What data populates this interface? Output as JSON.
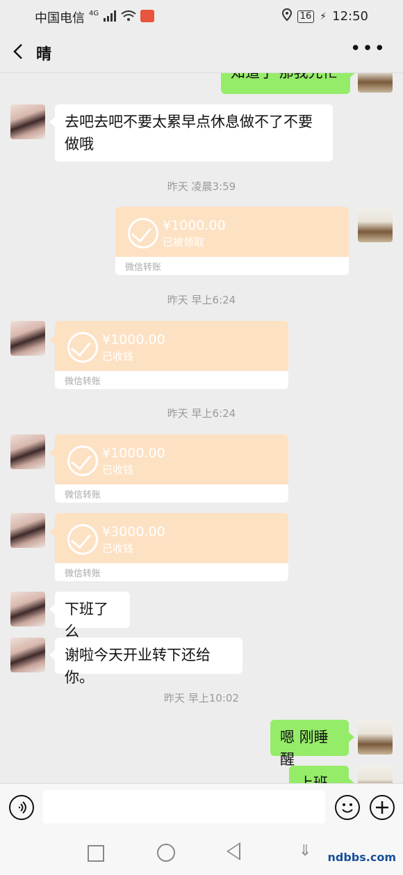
{
  "status_bar": {
    "carrier": "中国电信",
    "network": "4G",
    "battery": "16",
    "time": "12:50"
  },
  "header": {
    "title": "晴"
  },
  "messages": {
    "top_partial": "知道了 那我先忙",
    "msg1": "去吧去吧不要太累早点休息做不了不要做哦",
    "ts1": "昨天 凌晨3:59",
    "transfer1": {
      "amount": "¥1000.00",
      "status": "已被领取",
      "footer": "微信转账"
    },
    "ts2": "昨天 早上6:24",
    "transfer2": {
      "amount": "¥1000.00",
      "status": "已收钱",
      "footer": "微信转账"
    },
    "ts3": "昨天 早上6:24",
    "transfer3": {
      "amount": "¥1000.00",
      "status": "已收钱",
      "footer": "微信转账"
    },
    "transfer4": {
      "amount": "¥3000.00",
      "status": "已收钱",
      "footer": "微信转账"
    },
    "msg2": "下班了么",
    "msg3": "谢啦今天开业转下还给你。",
    "ts4": "昨天 早上10:02",
    "msg4": "嗯 刚睡醒",
    "bottom_partial": "上班了"
  },
  "colors": {
    "green_bubble": "#95ec69",
    "transfer_bg": "#fde1c3",
    "background": "#ededed"
  },
  "watermark": "ndbbs.com"
}
